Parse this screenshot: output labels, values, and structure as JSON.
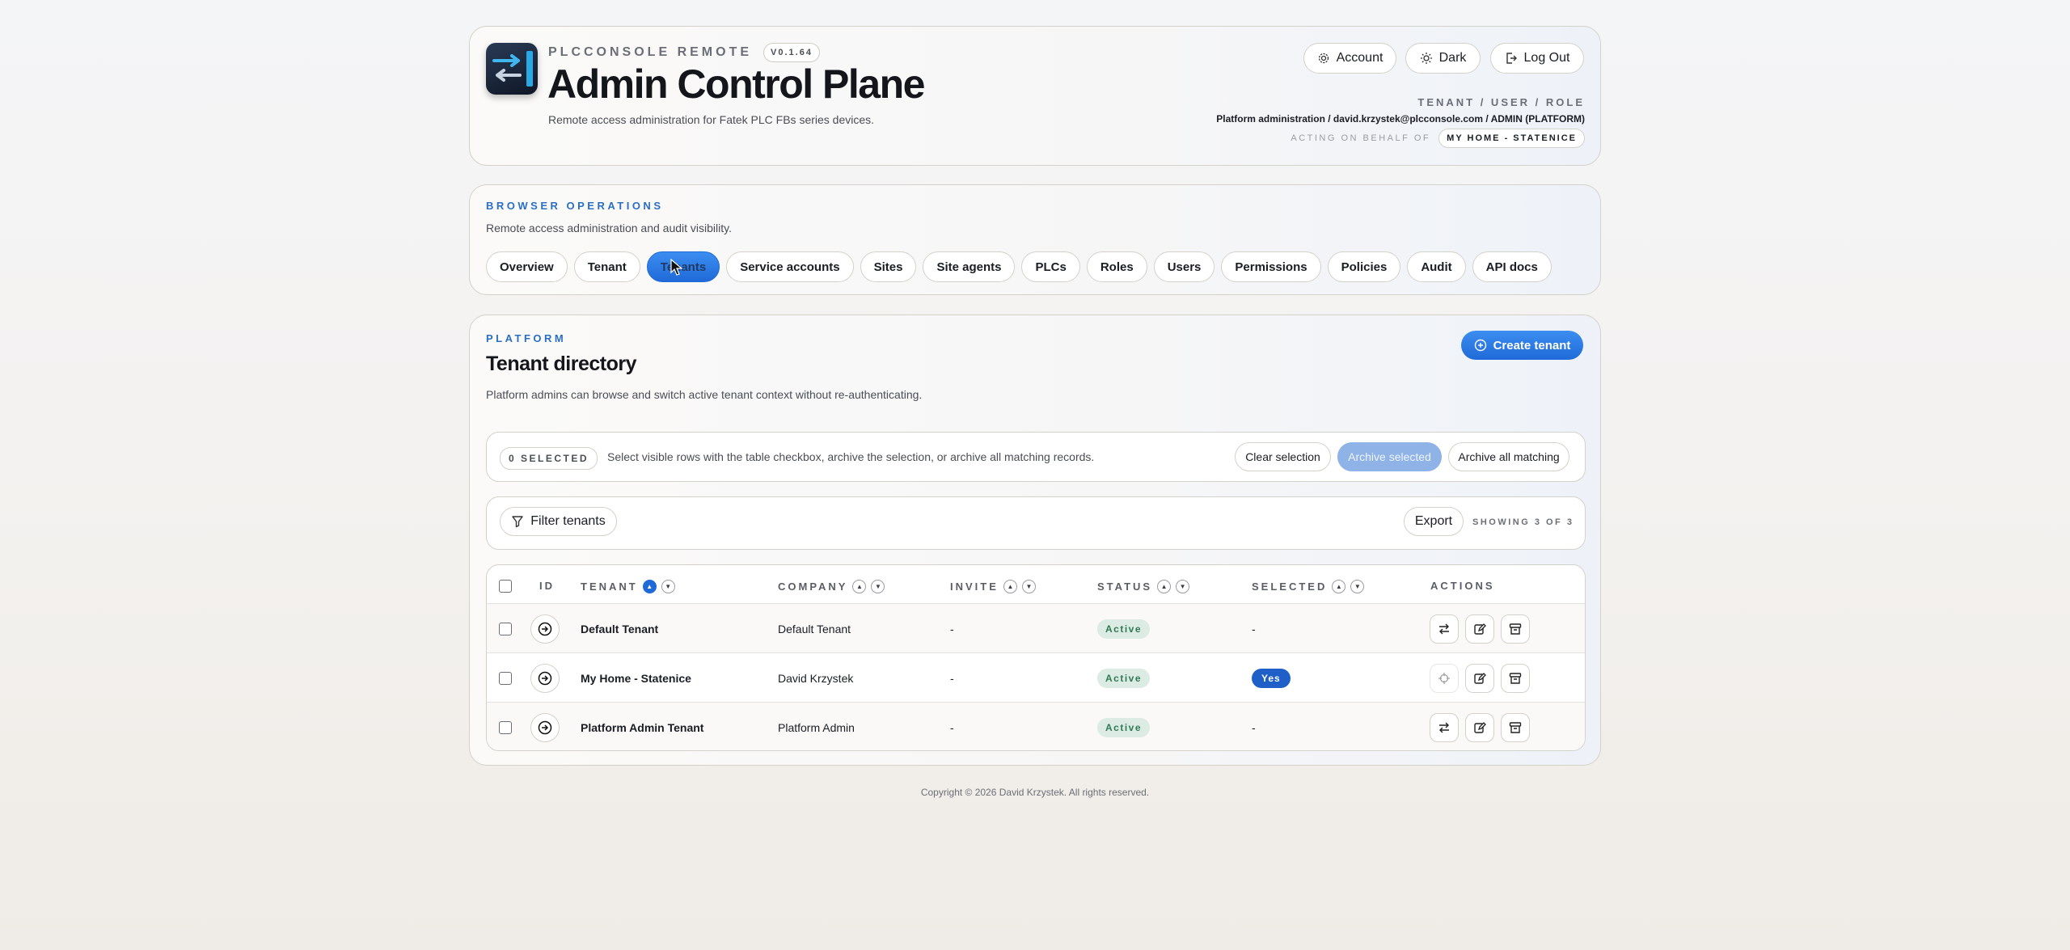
{
  "header": {
    "app_name": "PLCCONSOLE REMOTE",
    "version": "V0.1.64",
    "title": "Admin Control Plane",
    "subtitle": "Remote access administration for Fatek PLC FBs series devices.",
    "buttons": {
      "account": "Account",
      "dark": "Dark",
      "logout": "Log Out"
    },
    "meta_label": "TENANT / USER / ROLE",
    "meta_value": "Platform administration / david.krzystek@plcconsole.com / ADMIN (PLATFORM)",
    "acting_label": "ACTING ON BEHALF OF",
    "acting_value": "MY HOME - STATENICE"
  },
  "ops": {
    "eyebrow": "BROWSER OPERATIONS",
    "description": "Remote access administration and audit visibility.",
    "tabs": [
      "Overview",
      "Tenant",
      "Tenants",
      "Service accounts",
      "Sites",
      "Site agents",
      "PLCs",
      "Roles",
      "Users",
      "Permissions",
      "Policies",
      "Audit",
      "API docs"
    ],
    "active_tab": "Tenants"
  },
  "main": {
    "eyebrow": "PLATFORM",
    "title": "Tenant directory",
    "description": "Platform admins can browse and switch active tenant context without re-authenticating.",
    "create_button": "Create tenant",
    "selection": {
      "badge": "0 SELECTED",
      "hint": "Select visible rows with the table checkbox, archive the selection, or archive all matching records.",
      "clear": "Clear selection",
      "archive_selected": "Archive selected",
      "archive_all": "Archive all matching"
    },
    "filter": {
      "button": "Filter tenants",
      "export": "Export",
      "showing": "SHOWING 3 OF 3"
    },
    "table": {
      "columns": {
        "id": "ID",
        "tenant": "TENANT",
        "company": "COMPANY",
        "invite": "INVITE",
        "status": "STATUS",
        "selected": "SELECTED",
        "actions": "ACTIONS"
      },
      "rows": [
        {
          "tenant": "Default Tenant",
          "company": "Default Tenant",
          "invite": "-",
          "status": "Active",
          "selected": "-"
        },
        {
          "tenant": "My Home - Statenice",
          "company": "David Krzystek",
          "invite": "-",
          "status": "Active",
          "selected": "Yes"
        },
        {
          "tenant": "Platform Admin Tenant",
          "company": "Platform Admin",
          "invite": "-",
          "status": "Active",
          "selected": "-"
        }
      ]
    }
  },
  "footer": "Copyright © 2026 David Krzystek. All rights reserved.",
  "colors": {
    "accent": "#1f6ad8",
    "status_active_bg": "#dcebe3",
    "status_active_text": "#2f7a55",
    "yes_badge": "#1f5fc8"
  }
}
